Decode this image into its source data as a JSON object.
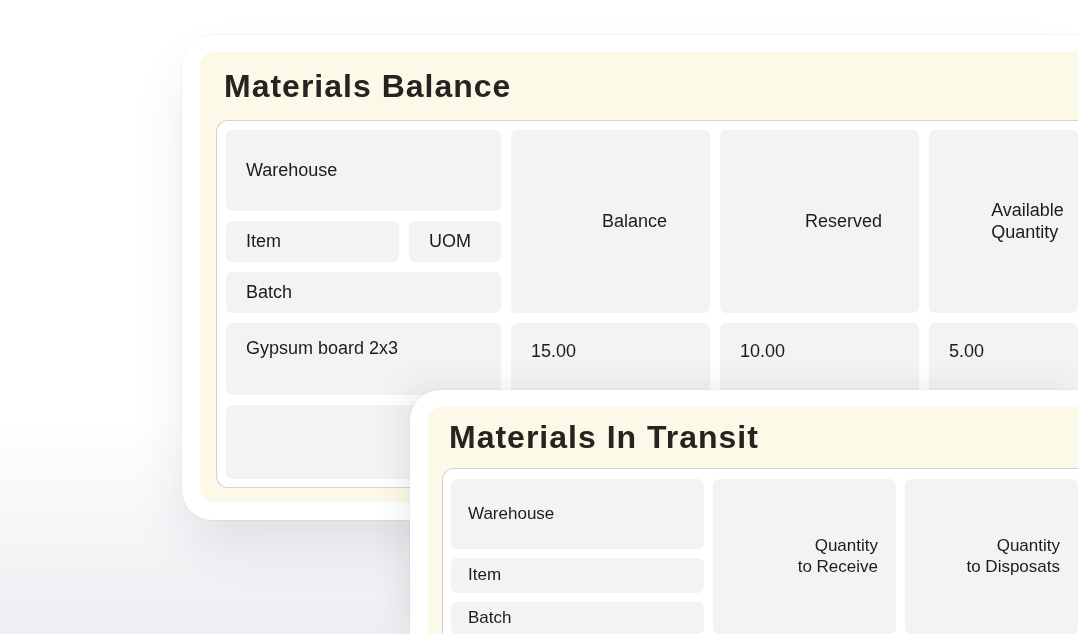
{
  "sheets": [
    {
      "title": "Materials Balance",
      "key_header": [
        [
          "Warehouse"
        ],
        [
          "Item",
          "UOM"
        ],
        [
          "Batch"
        ]
      ],
      "columns": [
        "Balance",
        "Reserved",
        "Available\nQuantity"
      ],
      "rows": [
        {
          "key": "Gypsum board 2x3",
          "values": [
            "15.00",
            "10.00",
            "5.00"
          ]
        }
      ]
    },
    {
      "title": "Materials In Transit",
      "key_header": [
        [
          "Warehouse"
        ],
        [
          "Item"
        ],
        [
          "Batch"
        ]
      ],
      "columns": [
        "Quantity\nto Receive",
        "Quantity\nto Disposats"
      ]
    }
  ]
}
